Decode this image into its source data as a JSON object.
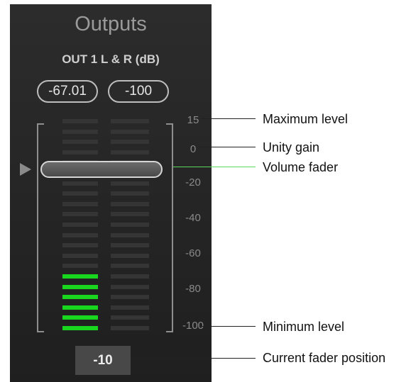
{
  "panel": {
    "title": "Outputs",
    "channel_label": "OUT 1 L & R (dB)",
    "readout_left": "-67.01",
    "readout_right": "-100",
    "current_position": "-10",
    "colors": {
      "meter_green": "#19d61e",
      "callout_line_green": "#5bd75b"
    }
  },
  "scale": {
    "ticks": [
      "15",
      "0",
      "-20",
      "-40",
      "-60",
      "-80",
      "-100"
    ]
  },
  "meters": {
    "left_level_percent": 28,
    "right_level_percent": 1
  },
  "callouts": {
    "maximum_level": "Maximum level",
    "unity_gain": "Unity gain",
    "volume_fader": "Volume fader",
    "minimum_level": "Minimum level",
    "current_fader_position": "Current fader position"
  }
}
